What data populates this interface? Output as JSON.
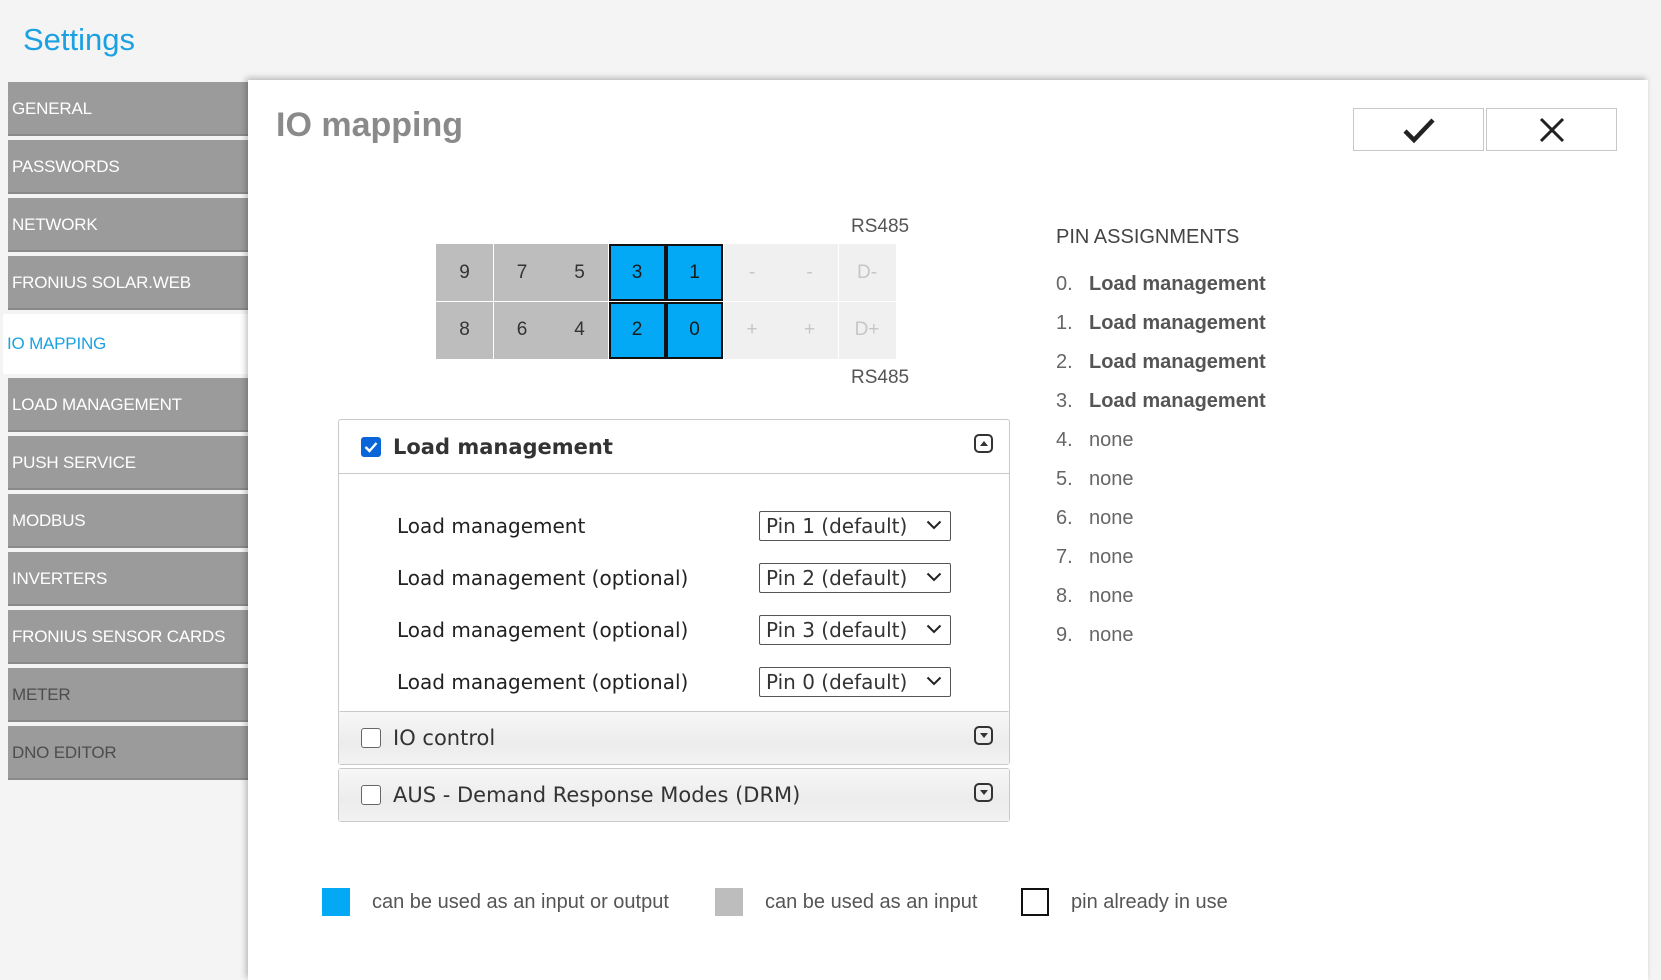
{
  "app_title": "Settings",
  "sidebar": [
    {
      "label": "GENERAL",
      "state": "normal"
    },
    {
      "label": "PASSWORDS",
      "state": "normal"
    },
    {
      "label": "NETWORK",
      "state": "normal"
    },
    {
      "label": "FRONIUS SOLAR.WEB",
      "state": "normal"
    },
    {
      "label": "IO MAPPING",
      "state": "active"
    },
    {
      "label": "LOAD MANAGEMENT",
      "state": "normal"
    },
    {
      "label": "PUSH SERVICE",
      "state": "normal"
    },
    {
      "label": "MODBUS",
      "state": "normal"
    },
    {
      "label": "INVERTERS",
      "state": "normal"
    },
    {
      "label": "FRONIUS SENSOR CARDS",
      "state": "normal"
    },
    {
      "label": "METER",
      "state": "disabled"
    },
    {
      "label": "DNO EDITOR",
      "state": "disabled"
    }
  ],
  "page_title": "IO mapping",
  "buttons": {
    "ok_icon": "check-icon",
    "cancel_icon": "close-icon"
  },
  "pins": {
    "rs485_top": "RS485",
    "rs485_bottom": "RS485",
    "top_row": [
      {
        "label": "9",
        "kind": "input"
      },
      {
        "label": "7",
        "kind": "input"
      },
      {
        "label": "5",
        "kind": "input"
      },
      {
        "label": "3",
        "kind": "io"
      },
      {
        "label": "1",
        "kind": "io"
      },
      {
        "label": "-",
        "kind": "rs"
      },
      {
        "label": "-",
        "kind": "rs"
      },
      {
        "label": "D-",
        "kind": "rs"
      }
    ],
    "bottom_row": [
      {
        "label": "8",
        "kind": "input"
      },
      {
        "label": "6",
        "kind": "input"
      },
      {
        "label": "4",
        "kind": "input"
      },
      {
        "label": "2",
        "kind": "io"
      },
      {
        "label": "0",
        "kind": "io"
      },
      {
        "label": "+",
        "kind": "rs"
      },
      {
        "label": "+",
        "kind": "rs"
      },
      {
        "label": "D+",
        "kind": "rs"
      }
    ]
  },
  "panels": {
    "load_management": {
      "title": "Load management",
      "checked": true,
      "rows": [
        {
          "label": "Load management",
          "value": "Pin 1 (default)"
        },
        {
          "label": "Load management (optional)",
          "value": "Pin 2 (default)"
        },
        {
          "label": "Load management (optional)",
          "value": "Pin 3 (default)"
        },
        {
          "label": "Load management (optional)",
          "value": "Pin 0 (default)"
        }
      ]
    },
    "io_control": {
      "title": "IO control",
      "checked": false
    },
    "drm": {
      "title": "AUS - Demand Response Modes (DRM)",
      "checked": false
    }
  },
  "assignments": {
    "title": "PIN ASSIGNMENTS",
    "items": [
      {
        "num": "0.",
        "value": "Load management",
        "bold": true
      },
      {
        "num": "1.",
        "value": "Load management",
        "bold": true
      },
      {
        "num": "2.",
        "value": "Load management",
        "bold": true
      },
      {
        "num": "3.",
        "value": "Load management",
        "bold": true
      },
      {
        "num": "4.",
        "value": "none",
        "bold": false
      },
      {
        "num": "5.",
        "value": "none",
        "bold": false
      },
      {
        "num": "6.",
        "value": "none",
        "bold": false
      },
      {
        "num": "7.",
        "value": "none",
        "bold": false
      },
      {
        "num": "8.",
        "value": "none",
        "bold": false
      },
      {
        "num": "9.",
        "value": "none",
        "bold": false
      }
    ]
  },
  "legend": {
    "io": "can be used as an input or output",
    "input": "can be used as an input",
    "in_use": "pin already in use"
  },
  "colors": {
    "accent": "#1ba1e2",
    "io_pin": "#03a9f4",
    "input_pin": "#bdbdbd",
    "nav": "#9b9b9b"
  }
}
